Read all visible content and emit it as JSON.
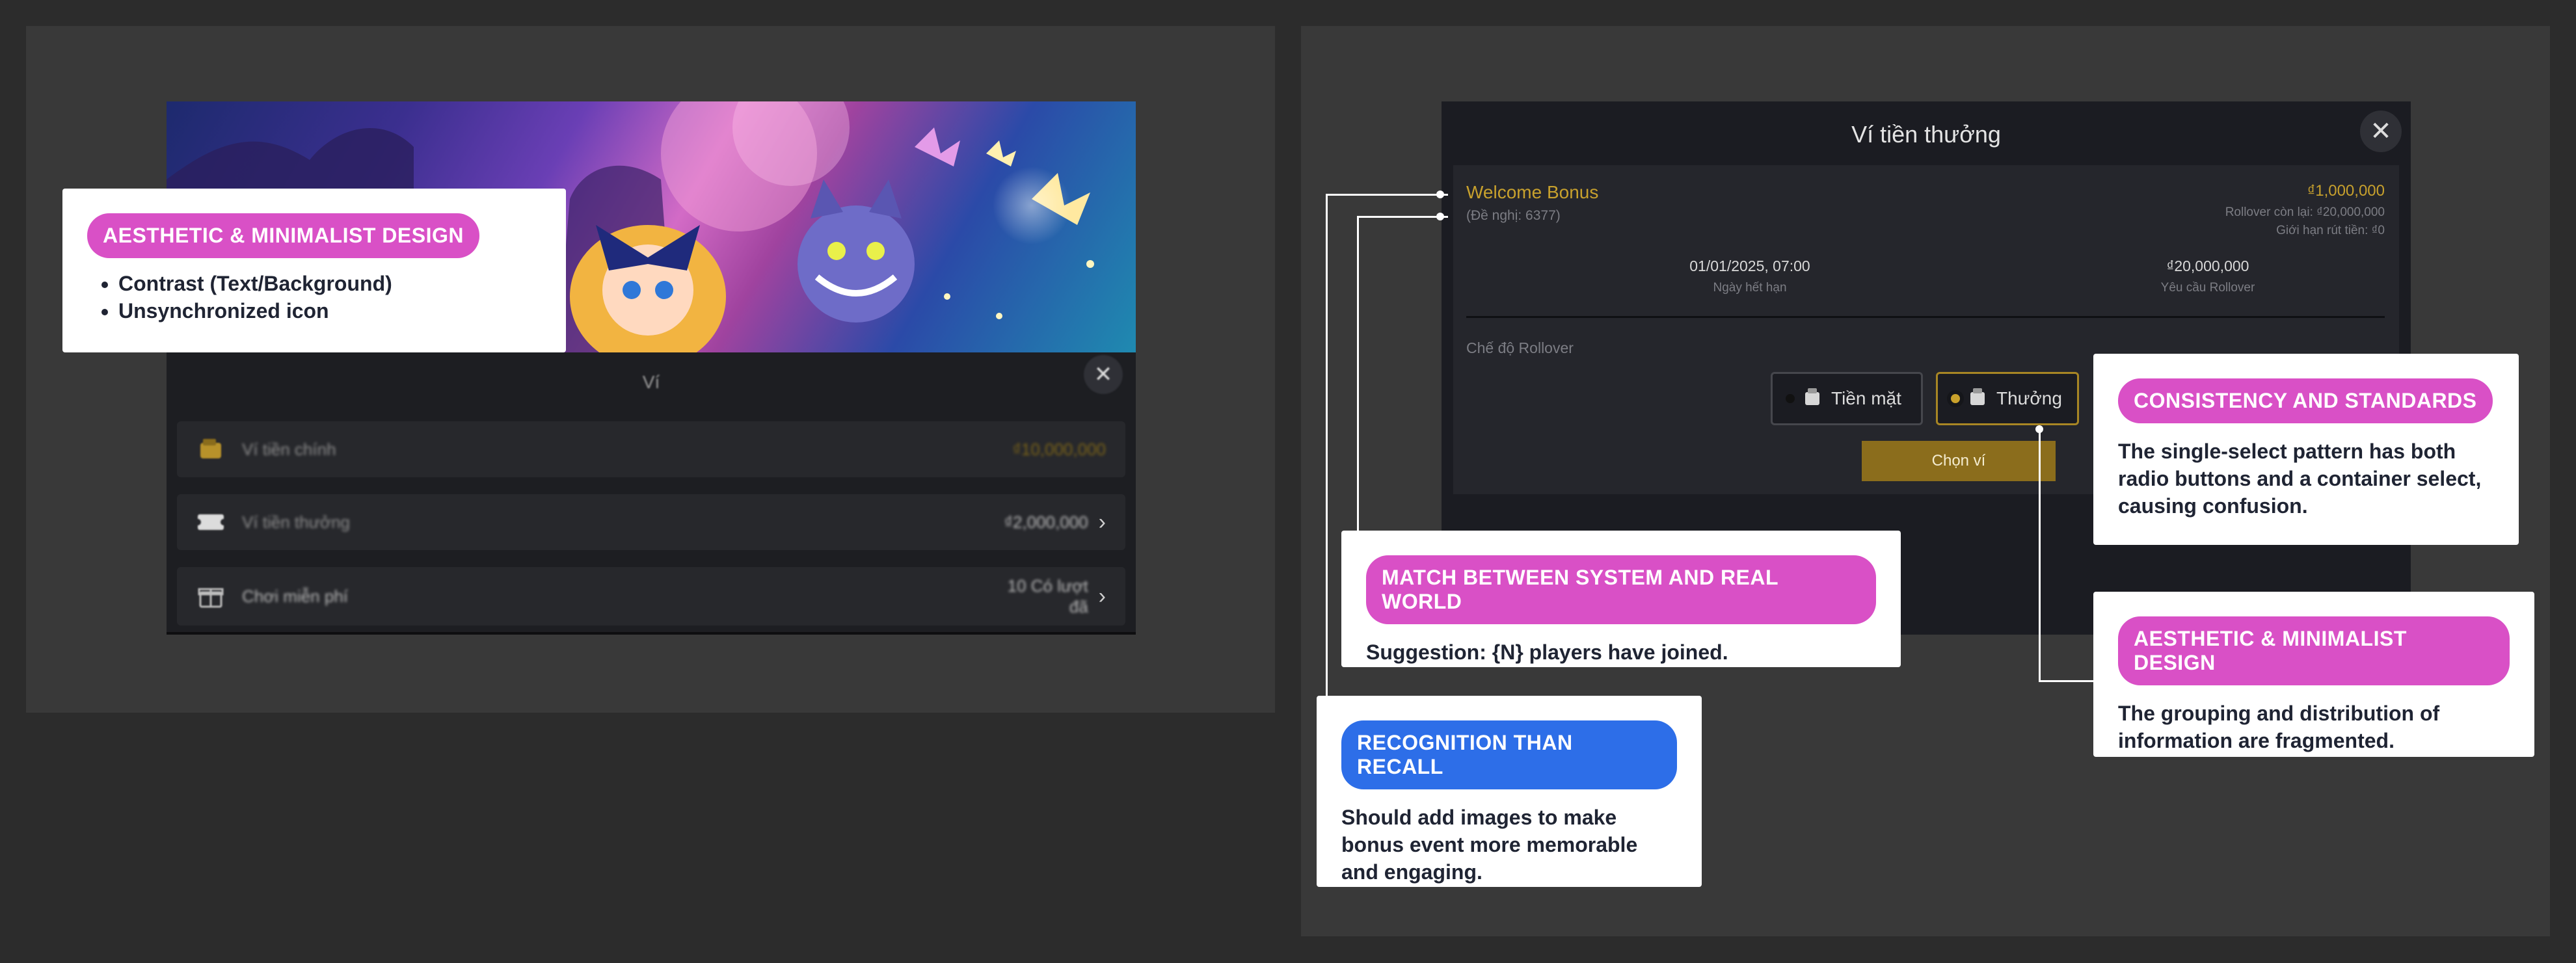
{
  "left_panel": {
    "wallet": {
      "title": "Ví",
      "rows": [
        {
          "label": "Ví tiền chính",
          "value": "₫10,000,000",
          "icon": "wallet-icon"
        },
        {
          "label": "Ví tiền thưởng",
          "value": "₫2,000,000",
          "icon": "ticket-icon"
        },
        {
          "label": "Chơi miễn phí",
          "value": "10 Có lượt đã",
          "icon": "gift-icon"
        }
      ]
    }
  },
  "modal": {
    "title": "Ví tiền thưởng",
    "bonus_name": "Welcome Bonus",
    "suggestion": "(Đề nghị: 6377)",
    "amount": "₫1,000,000",
    "rollover_remaining": "Rollover còn lại: ₫20,000,000",
    "withdraw_limit": "Giới hạn rút tiền: ₫0",
    "expiry_value": "01/01/2025, 07:00",
    "expiry_label": "Ngày hết hạn",
    "rollover_value": "₫20,000,000",
    "rollover_label": "Yêu cầu Rollover",
    "rollover_mode_label": "Chế độ Rollover",
    "option_cash": "Tiền mặt",
    "option_bonus": "Thưởng",
    "select_button": "Chọn ví"
  },
  "callouts": {
    "left_aesthetic": {
      "tag": "AESTHETIC & MINIMALIST DESIGN",
      "items": [
        "Contrast (Text/Background)",
        "Unsynchronized icon"
      ]
    },
    "consistency": {
      "tag": "CONSISTENCY AND STANDARDS",
      "text": "The single-select pattern has both radio buttons and a container select, causing confusion."
    },
    "match_real_world": {
      "tag": "MATCH BETWEEN SYSTEM AND REAL WORLD",
      "text": "Suggestion: {N} players have joined."
    },
    "right_aesthetic": {
      "tag": "AESTHETIC & MINIMALIST DESIGN",
      "text": "The grouping and distribution of information are fragmented."
    },
    "recognition": {
      "tag": "RECOGNITION THAN RECALL",
      "text": "Should add images to make bonus event more memorable and engaging."
    }
  },
  "colors": {
    "background": "#2c2c2c",
    "frame": "#393939",
    "tag_pink": "#d950c6",
    "tag_blue": "#2d6ee8",
    "gold": "#c8a12d"
  }
}
